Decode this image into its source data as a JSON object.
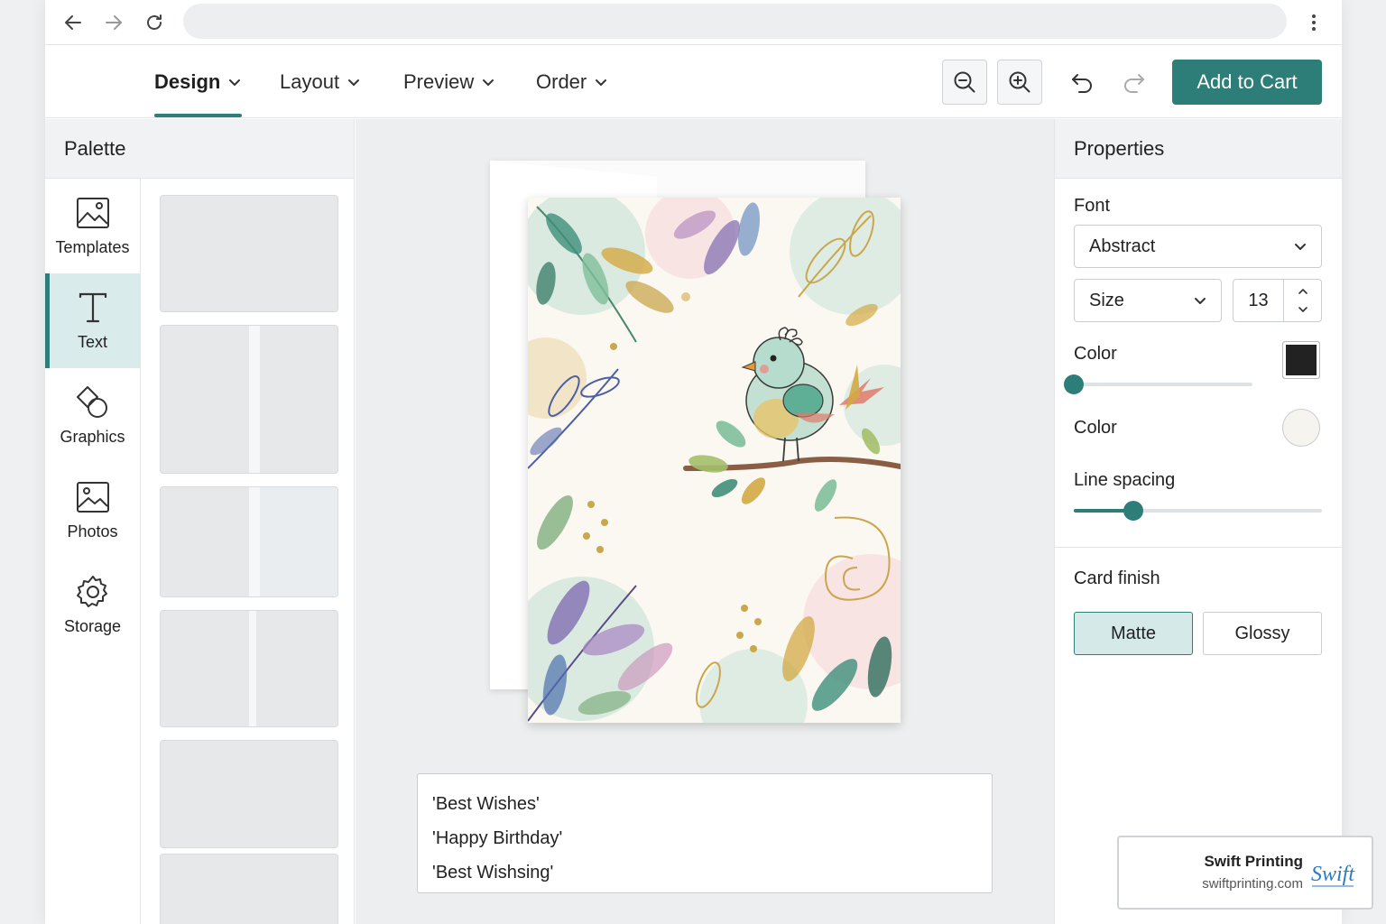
{
  "toolbar": {
    "menus": [
      {
        "label": "Design",
        "active": true
      },
      {
        "label": "Layout",
        "active": false
      },
      {
        "label": "Preview",
        "active": false
      },
      {
        "label": "Order",
        "active": false
      }
    ],
    "add_to_cart_label": "Add to Cart",
    "icons": [
      "zoom-out-icon",
      "zoom-in-icon",
      "undo-icon",
      "redo-icon"
    ]
  },
  "palette": {
    "title": "Palette",
    "items": [
      {
        "label": "Templates",
        "icon": "image-icon"
      },
      {
        "label": "Text",
        "icon": "text-icon",
        "active": true
      },
      {
        "label": "Graphics",
        "icon": "shapes-icon"
      },
      {
        "label": "Photos",
        "icon": "photo-icon"
      },
      {
        "label": "Storage",
        "icon": "gear-icon"
      }
    ]
  },
  "canvas": {
    "text_options": [
      "'Best Wishes'",
      "'Happy Birthday'",
      "'Best Wishsing'"
    ]
  },
  "properties": {
    "title": "Properties",
    "font_label": "Font",
    "font_value": "Abstract",
    "size_label": "Size",
    "size_value": "13",
    "color_label_1": "Color",
    "color_1": "#222222",
    "color_1_slider": 0.0,
    "color_label_2": "Color",
    "color_2": "#f6f4ee",
    "line_spacing_label": "Line spacing",
    "line_spacing_value": 0.24,
    "card_finish_label": "Card finish",
    "finish_options": [
      {
        "label": "Matte",
        "active": true
      },
      {
        "label": "Glossy",
        "active": false
      }
    ]
  },
  "brand": {
    "name": "Swift Printing",
    "url": "swiftprinting.com",
    "logo_text": "Swift"
  },
  "colors": {
    "accent": "#2d7d78",
    "accent_light": "#d9ebea"
  }
}
